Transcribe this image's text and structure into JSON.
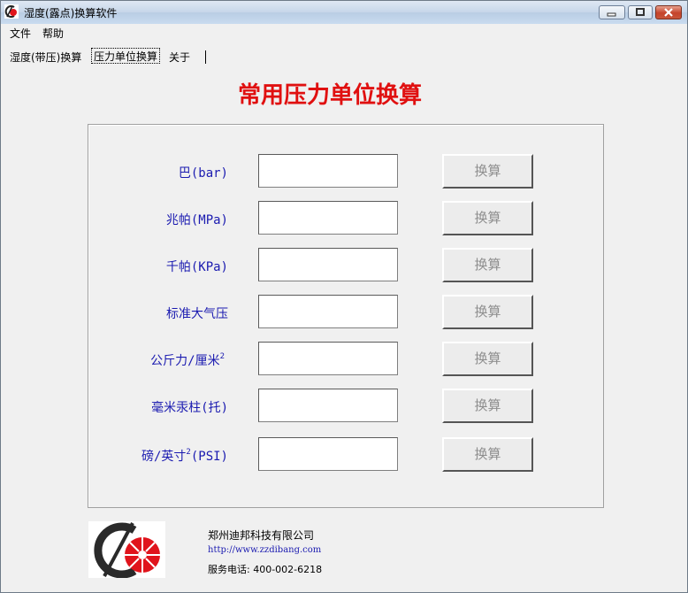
{
  "window": {
    "title": "湿度(露点)换算软件"
  },
  "menu": {
    "file": "文件",
    "help": "帮助"
  },
  "tabs": [
    {
      "label": "湿度(带压)换算"
    },
    {
      "label": "压力单位换算"
    },
    {
      "label": "关于"
    }
  ],
  "heading": "常用压力单位换算",
  "rows": [
    {
      "label": "巴(bar)",
      "value": "",
      "button": "换算"
    },
    {
      "label": "兆帕(MPa)",
      "value": "",
      "button": "换算"
    },
    {
      "label": "千帕(KPa)",
      "value": "",
      "button": "换算"
    },
    {
      "label": "标准大气压",
      "value": "",
      "button": "换算"
    },
    {
      "label": "公斤力/厘米",
      "sup": "2",
      "value": "",
      "button": "换算"
    },
    {
      "label": "毫米汞柱(托)",
      "value": "",
      "button": "换算"
    },
    {
      "label": "磅/英寸",
      "sup": "2",
      "suffix": "(PSI)",
      "value": "",
      "button": "换算"
    }
  ],
  "footer": {
    "company": "郑州迪邦科技有限公司",
    "url": "http://www.zzdibang.com",
    "phone": "服务电话: 400-002-6218"
  },
  "colors": {
    "heading": "#e01010",
    "labels": "#1a1ab0",
    "logo_red": "#e0141c"
  }
}
